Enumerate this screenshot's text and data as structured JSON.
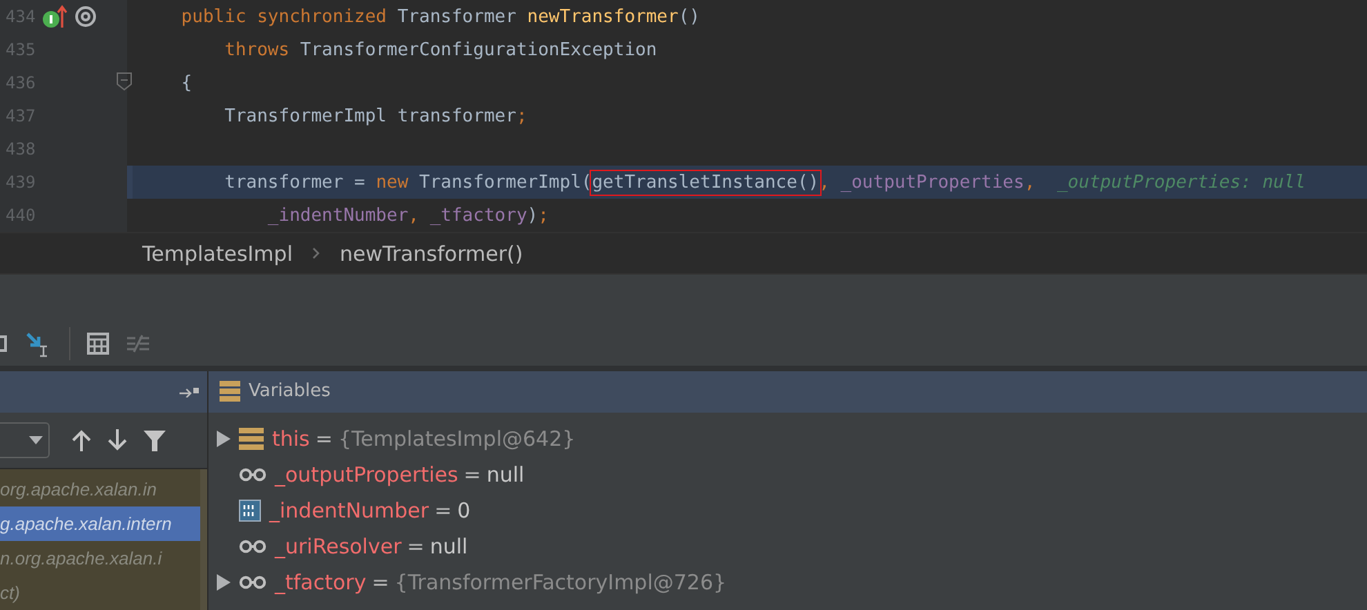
{
  "editor": {
    "lines": [
      {
        "number": "434",
        "kind": "declaration",
        "fold": false,
        "highlighted": false,
        "tokens": [
          {
            "kind": "keyword",
            "text": "    public synchronized "
          },
          {
            "kind": "plain",
            "text": "Transformer "
          },
          {
            "kind": "method",
            "text": "newTransformer"
          },
          {
            "kind": "plain",
            "text": "()"
          }
        ]
      },
      {
        "number": "435",
        "kind": "code",
        "fold": false,
        "highlighted": false,
        "tokens": [
          {
            "kind": "keyword",
            "text": "        throws "
          },
          {
            "kind": "plain",
            "text": "TransformerConfigurationException"
          }
        ]
      },
      {
        "number": "436",
        "kind": "code",
        "fold": true,
        "highlighted": false,
        "tokens": [
          {
            "kind": "plain",
            "text": "    {"
          }
        ]
      },
      {
        "number": "437",
        "kind": "code",
        "fold": false,
        "highlighted": false,
        "tokens": [
          {
            "kind": "plain",
            "text": "        TransformerImpl transformer"
          },
          {
            "kind": "keyword",
            "text": ";"
          }
        ]
      },
      {
        "number": "438",
        "kind": "code",
        "fold": false,
        "highlighted": false
      },
      {
        "number": "439",
        "kind": "code",
        "fold": false,
        "highlighted": true,
        "tokens": [
          {
            "kind": "plain",
            "text": "        transformer = "
          },
          {
            "kind": "keyword",
            "text": "new "
          },
          {
            "kind": "plain",
            "text": "TransformerImpl("
          },
          {
            "kind": "framed",
            "text": "getTransletInstance()"
          },
          {
            "kind": "keyword",
            "text": ", "
          },
          {
            "kind": "field",
            "text": "_outputProperties"
          },
          {
            "kind": "keyword",
            "text": ", "
          },
          {
            "kind": "hint",
            "text": "_outputProperties: null"
          }
        ]
      },
      {
        "number": "440",
        "kind": "code",
        "fold": false,
        "highlighted": false,
        "tokens": [
          {
            "kind": "field",
            "text": "            _indentNumber"
          },
          {
            "kind": "keyword",
            "text": ", "
          },
          {
            "kind": "field",
            "text": "_tfactory"
          },
          {
            "kind": "plain",
            "text": ")"
          },
          {
            "kind": "keyword",
            "text": ";"
          }
        ]
      }
    ]
  },
  "breadcrumb": [
    "TemplatesImpl",
    "newTransformer()"
  ],
  "toolbar": [
    {
      "kind": "cut"
    },
    {
      "kind": "run_to_cursor",
      "disabled": false
    },
    {
      "kind": "separator"
    },
    {
      "kind": "evaluate",
      "disabled": false
    },
    {
      "kind": "trace",
      "disabled": true
    }
  ],
  "frames": {
    "items": [
      {
        "text": "org.apache.xalan.in",
        "selected": false
      },
      {
        "text": "g.apache.xalan.intern",
        "selected": true
      },
      {
        "text": "n.org.apache.xalan.i",
        "selected": false
      },
      {
        "text": "ct)",
        "selected": false
      }
    ]
  },
  "variables": {
    "title": "Variables",
    "items": [
      {
        "kind": "object",
        "expandable": true,
        "name": "this",
        "separator": "=",
        "value": "{TemplatesImpl@642}"
      },
      {
        "kind": "field",
        "expandable": false,
        "name": "_outputProperties",
        "separator": "=",
        "value": "null"
      },
      {
        "kind": "primitive",
        "expandable": false,
        "name": "_indentNumber",
        "separator": "=",
        "value": "0"
      },
      {
        "kind": "field",
        "expandable": false,
        "name": "_uriResolver",
        "separator": "=",
        "value": "null"
      },
      {
        "kind": "field_object",
        "expandable": true,
        "name": "_tfactory",
        "separator": "=",
        "value": "{TransformerFactoryImpl@726}"
      }
    ]
  }
}
